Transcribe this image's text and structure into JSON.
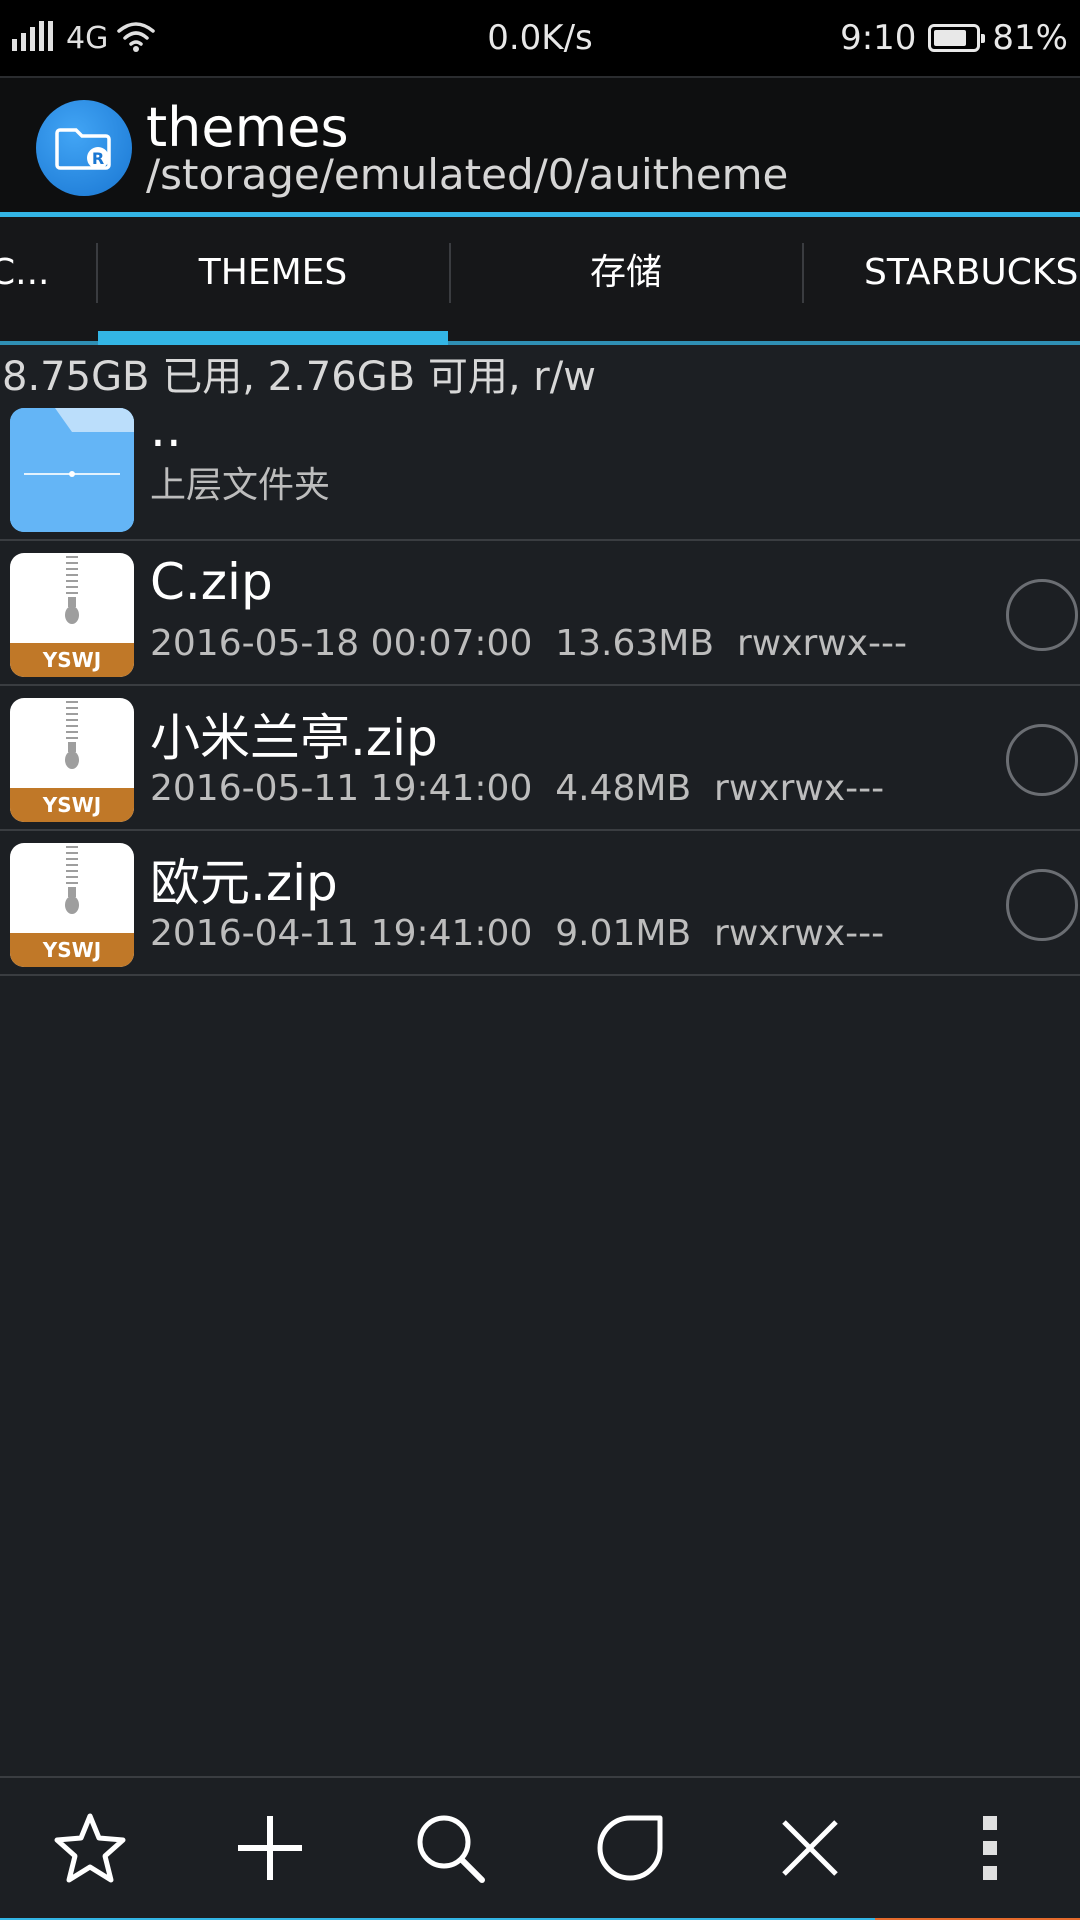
{
  "status_bar": {
    "network": "4G",
    "speed": "0.0K/s",
    "time": "9:10",
    "battery": "81%",
    "battery_level": 0.81
  },
  "header": {
    "title": "themes",
    "path": "/storage/emulated/0/auitheme",
    "icon": "folder-app-icon"
  },
  "tabs": [
    {
      "label": "C..."
    },
    {
      "label": "THEMES",
      "active": true
    },
    {
      "label": "存储"
    },
    {
      "label": "STARBUCKS"
    }
  ],
  "storage_info": "8.75GB 已用, 2.76GB 可用, r/w",
  "files": [
    {
      "name": "..",
      "sub": "上层文件夹",
      "type": "parent-folder"
    },
    {
      "name": "C.zip",
      "date": "2016-05-18 00:07:00",
      "size": "13.63MB",
      "perms": "rwxrwx---",
      "type": "zip",
      "badge": "YSWJ"
    },
    {
      "name": "小米兰亭.zip",
      "date": "2016-05-11 19:41:00",
      "size": "4.48MB",
      "perms": "rwxrwx---",
      "type": "zip",
      "badge": "YSWJ"
    },
    {
      "name": "欧元.zip",
      "date": "2016-04-11 19:41:00",
      "size": "9.01MB",
      "perms": "rwxrwx---",
      "type": "zip",
      "badge": "YSWJ"
    }
  ],
  "toolbar": {
    "icons": [
      "star-icon",
      "add-icon",
      "search-icon",
      "select-icon",
      "close-icon",
      "more-icon"
    ]
  },
  "colors": {
    "accent": "#33b5e5",
    "background": "#1c1f23",
    "header_bg": "#0e0f10",
    "zip_band": "#c07828",
    "folder": "#64b5f6"
  }
}
